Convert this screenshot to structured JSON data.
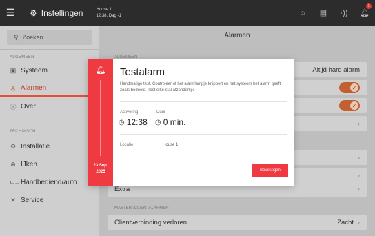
{
  "topbar": {
    "title": "Instellingen",
    "house": "House 1",
    "datetime": "12:38, Dag -1",
    "badge_count": "1",
    "icons": [
      "menu-icon",
      "settings-icon",
      "home-icon",
      "document-icon",
      "signal-icon",
      "bell-icon"
    ]
  },
  "sidebar": {
    "search_placeholder": "Zoeken",
    "section_general": "ALGEMEEN",
    "section_technical": "TECHNISCH",
    "items": [
      {
        "label": "Systeem",
        "icon": "system-icon"
      },
      {
        "label": "Alarmen",
        "icon": "alarm-icon"
      },
      {
        "label": "Over",
        "icon": "info-icon"
      },
      {
        "label": "Installatie",
        "icon": "installation-icon"
      },
      {
        "label": "IJken",
        "icon": "calibrate-icon"
      },
      {
        "label": "Handbediend/auto",
        "icon": "manual-icon"
      },
      {
        "label": "Service",
        "icon": "service-icon"
      }
    ]
  },
  "main": {
    "header": "Alarmen",
    "section_general": "ALGEMEEN",
    "row_top_value": "Altijd hard alarm",
    "row_extra": "Extra",
    "section_master": "MASTER-/CLIENTALARMEN",
    "row_client": "Clientverbinding verloren",
    "row_client_value": "Zacht"
  },
  "dialog": {
    "title": "Testalarm",
    "description": "Handmatige test. Controleer of het alarmlampje knippert en het systeem het alarm geeft zoals bedoeld. Test elke stal afzonderlijk.",
    "activation_label": "Activering",
    "activation_value": "12:38",
    "duration_label": "Duur",
    "duration_value": "0 min.",
    "location_label": "Locatie",
    "location_value": "House 1",
    "date_line1": "23 Sep.",
    "date_line2": "2025",
    "confirm_button": "Bevestigen"
  },
  "colors": {
    "accent_red": "#ef3a42",
    "toggle_on": "#c25f33",
    "topbar_bg": "#2c2c2c"
  }
}
